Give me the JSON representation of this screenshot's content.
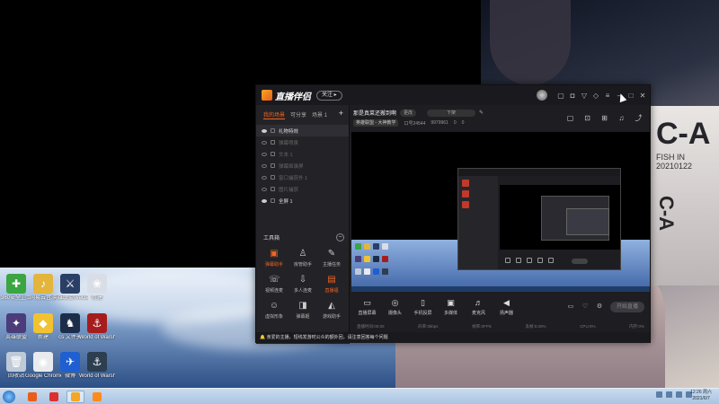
{
  "desktop": {
    "icons": [
      {
        "label": "360安全卫士",
        "color": "#3aa541",
        "glyph": "✚",
        "icon": "shield-icon"
      },
      {
        "label": "网易云音乐",
        "color": "#e3b53c",
        "glyph": "♪",
        "icon": "folder-icon"
      },
      {
        "label": "英雄联盟WeGame版",
        "color": "#2a3f66",
        "glyph": "⚔",
        "icon": "game-icon"
      },
      {
        "label": "新建",
        "color": "#d9dde6",
        "glyph": "❀",
        "icon": "image-icon"
      },
      {
        "label": "英雄联盟",
        "color": "#4b3c7a",
        "glyph": "✦",
        "icon": "game-icon"
      },
      {
        "label": "新建",
        "color": "#f1c232",
        "glyph": "◆",
        "icon": "folder-icon"
      },
      {
        "label": "cs 文件夹",
        "color": "#1c2d4a",
        "glyph": "♞",
        "icon": "game-icon"
      },
      {
        "label": "World of Warships",
        "color": "#a61c1c",
        "glyph": "⚓",
        "icon": "game-icon"
      },
      {
        "label": "回收站",
        "color": "#bfcad8",
        "glyph": "🗑",
        "icon": "recycle-bin-icon"
      },
      {
        "label": "Google Chrome",
        "color": "#e8eaed",
        "glyph": "◉",
        "icon": "chrome-icon"
      },
      {
        "label": "微博",
        "color": "#1f5fd1",
        "glyph": "✈",
        "icon": "app-icon"
      },
      {
        "label": "World of Warships",
        "color": "#2c3e50",
        "glyph": "⚓",
        "icon": "game-icon"
      }
    ]
  },
  "poster": {
    "big": "C-A",
    "sub": "FISH IN",
    "date": "20210122",
    "vertical": "C-A"
  },
  "app": {
    "brand": "直播伴侣",
    "follow": "关注 ▸",
    "tabs": [
      "我的场景",
      "可分享",
      "场景 1"
    ],
    "scenes": [
      {
        "label": "礼物特效",
        "on": true
      },
      {
        "label": "弹幕喷泉",
        "on": false
      },
      {
        "label": "文本 1",
        "on": false
      },
      {
        "label": "弹幕姬录屏",
        "on": false
      },
      {
        "label": "窗口捕获外 1",
        "on": false
      },
      {
        "label": "图片捕获",
        "on": false
      },
      {
        "label": "全屏 1",
        "on": true
      }
    ],
    "tools_title": "工具箱",
    "tools": [
      {
        "label": "弹幕助手",
        "glyph": "▣",
        "hot": true,
        "icon": "danmaku-icon"
      },
      {
        "label": "房管助手",
        "glyph": "♙",
        "hot": false,
        "icon": "user-icon"
      },
      {
        "label": "主播任务",
        "glyph": "✎",
        "hot": false,
        "icon": "task-icon"
      },
      {
        "label": "视频连麦",
        "glyph": "☏",
        "hot": false,
        "icon": "video-call-icon"
      },
      {
        "label": "多人连麦",
        "glyph": "⇩",
        "hot": false,
        "icon": "multi-call-icon"
      },
      {
        "label": "直播福",
        "glyph": "▤",
        "hot": true,
        "icon": "gift-icon"
      },
      {
        "label": "虚拟形象",
        "glyph": "☺",
        "hot": false,
        "icon": "avatar-icon"
      },
      {
        "label": "弹幕姬",
        "glyph": "◨",
        "hot": false,
        "icon": "danmaku-box-icon"
      },
      {
        "label": "游戏助手",
        "glyph": "◭",
        "hot": false,
        "icon": "game-helper-icon"
      }
    ],
    "notice": "🔔 亲爱的主播，短线发游时公众的额外回，请注意回答每个问题",
    "room_title": "那是真菜还搬到啊",
    "room_pill": "更改",
    "room_pill2": "下架",
    "category": "英雄联盟 - 大神教学",
    "room_id": "口号24544",
    "fans": "9979961",
    "likes": "0",
    "comments": "0",
    "right_icons": [
      {
        "glyph": "▢",
        "icon": "screenshot-icon"
      },
      {
        "glyph": "⊡",
        "icon": "lock-icon"
      },
      {
        "glyph": "⊞",
        "icon": "layout-icon"
      },
      {
        "glyph": "♫",
        "icon": "bell-icon"
      },
      {
        "glyph": "⤴",
        "icon": "share-icon"
      }
    ],
    "bottom": [
      {
        "label": "直播屏幕",
        "glyph": "▭",
        "icon": "screen-icon"
      },
      {
        "label": "摄像头",
        "glyph": "◎",
        "icon": "camera-icon"
      },
      {
        "label": "手机投屏",
        "glyph": "▯",
        "icon": "phone-icon"
      },
      {
        "label": "多媒体",
        "glyph": "▣",
        "icon": "media-icon"
      },
      {
        "label": "麦克风",
        "glyph": "♬",
        "icon": "microphone-icon"
      },
      {
        "label": "扬声器",
        "glyph": "◀",
        "icon": "speaker-icon"
      }
    ],
    "start_live": "开始直播",
    "status": [
      "直播时间:00:00",
      "码率:0kbps",
      "帧率:0FPS",
      "丢帧:0.00%",
      "CPU:0%",
      "内存:0%"
    ]
  },
  "taskbar": {
    "clock_time": "12:26 周六",
    "clock_date": "2021/6/7",
    "apps": [
      {
        "color": "#e95d1a",
        "icon": "chrome-icon",
        "active": false
      },
      {
        "color": "#dc2f2f",
        "icon": "netease-music-icon",
        "active": false
      },
      {
        "color": "#f5a623",
        "icon": "live-companion-icon",
        "active": true
      },
      {
        "color": "#ff8c1a",
        "icon": "app-icon",
        "active": false
      }
    ]
  }
}
